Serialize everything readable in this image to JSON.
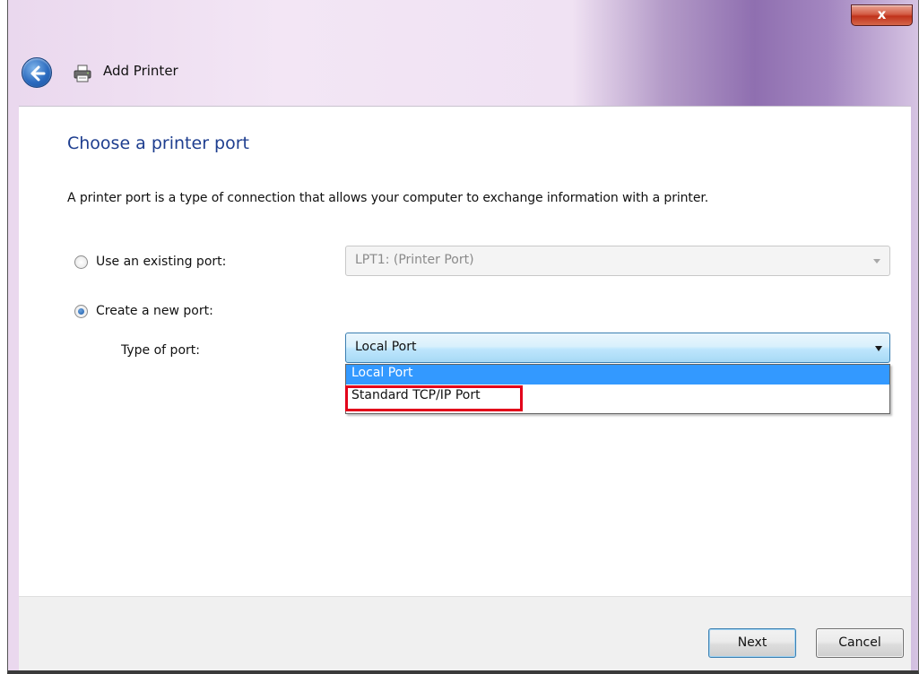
{
  "window": {
    "title": "Add Printer",
    "close_label": "x"
  },
  "content": {
    "heading": "Choose a printer port",
    "description": "A printer port is a type of connection that allows your computer to exchange information with a printer."
  },
  "options": {
    "existing": {
      "label": "Use an existing port:",
      "selected": false,
      "combo_value": "LPT1: (Printer Port)",
      "enabled": false
    },
    "new": {
      "label": "Create a new port:",
      "selected": true
    }
  },
  "port_type": {
    "label": "Type of port:",
    "value": "Local Port",
    "dropdown_open": true,
    "options": [
      "Local Port",
      "Standard TCP/IP Port"
    ],
    "highlighted_option_index": 0
  },
  "footer": {
    "next_label": "Next",
    "cancel_label": "Cancel"
  },
  "icons": {
    "back": "back-arrow-icon",
    "printer": "printer-icon",
    "close": "close-icon"
  },
  "colors": {
    "heading": "#1e3e8f",
    "selection": "#3399ff",
    "annotation": "#e2001a",
    "close_button": "#c0321b"
  }
}
